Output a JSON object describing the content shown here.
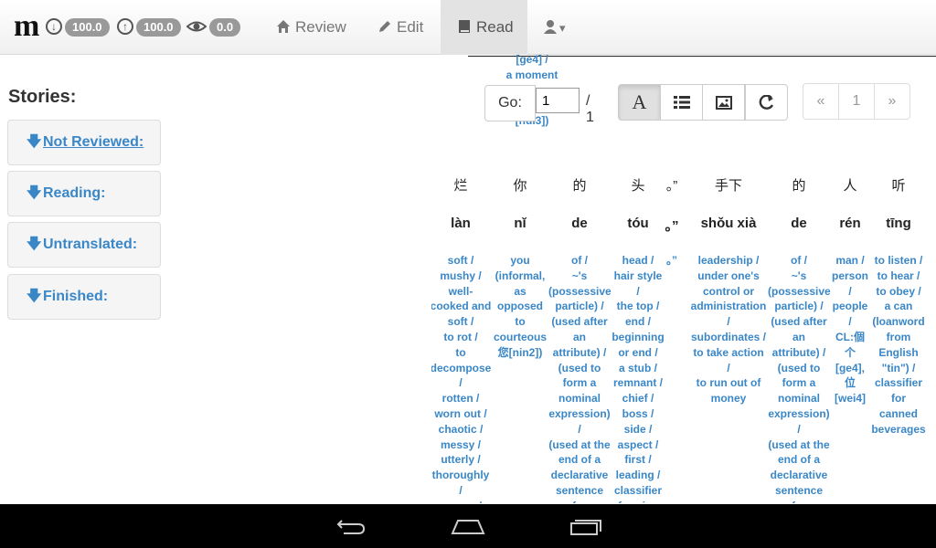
{
  "nav": {
    "logo": "m",
    "stats": [
      {
        "icon": "download-circle-icon",
        "value": "100.0"
      },
      {
        "icon": "upload-circle-icon",
        "value": "100.0"
      },
      {
        "icon": "eye-icon",
        "value": "0.0"
      }
    ],
    "review": "Review",
    "edit": "Edit",
    "read": "Read",
    "user_caret": "▾"
  },
  "stories": {
    "title": "Stories:",
    "items": [
      {
        "label": "Not Reviewed:"
      },
      {
        "label": "Reading:"
      },
      {
        "label": "Untranslated:"
      },
      {
        "label": "Finished:"
      }
    ]
  },
  "reader": {
    "go_label": "Go:",
    "page_input": "1",
    "page_total": "/ 1",
    "font_button": "A",
    "pager": {
      "prev": "«",
      "current": "1",
      "next": "»"
    },
    "floating_text": "[ge4] /\na moment\n\nsense is\n[hui3])",
    "columns": [
      {
        "zh": "烂",
        "py": "làn",
        "def": "soft /\nmushy /\nwell-\ncooked and\nsoft /\nto rot /\nto\ndecompose\n/\nrotten /\nworn out /\nchaotic /\nmessy /\nutterly /\nthoroughly\n/\ncrappy /"
      },
      {
        "zh": "你",
        "py": "nǐ",
        "def": "you\n(informal,\nas\nopposed\nto\ncourteous\n您[nin2])"
      },
      {
        "zh": "的",
        "py": "de",
        "def": "of /\n~'s\n(possessive\nparticle) /\n(used after\nan\nattribute) /\n(used to\nform a\nnominal\nexpression)\n/\n(used at the\nend of a\ndeclarative\nsentence\nfor"
      },
      {
        "zh": "头",
        "py": "tóu",
        "def": "head /\nhair style\n/\nthe top /\nend /\nbeginning\nor end /\na stub /\nremnant /\nchief /\nboss /\nside /\naspect /\nfirst /\nleading /\nclassifier\nfor pigs"
      },
      {
        "zh": "。”",
        "py": "。”",
        "def": "。”"
      },
      {
        "zh": "手下",
        "py": "shǒu xià",
        "def": "leadership /\nunder one's\ncontrol or\nadministration\n/\nsubordinates /\nto take action\n/\nto run out of\nmoney"
      },
      {
        "zh": "的",
        "py": "de",
        "def": "of /\n~'s\n(possessive\nparticle) /\n(used after\nan\nattribute) /\n(used to\nform a\nnominal\nexpression)\n/\n(used at the\nend of a\ndeclarative\nsentence\nfor"
      },
      {
        "zh": "人",
        "py": "rén",
        "def": "man /\nperson\n/\npeople\n/\nCL:個\n个\n[ge4],\n位\n[wei4]"
      },
      {
        "zh": "听",
        "py": "tīng",
        "def": "to listen /\nto hear /\nto obey /\na can\n(loanword\nfrom\nEnglish\n\"tin\") /\nclassifier\nfor\ncanned\nbeverages"
      }
    ]
  }
}
